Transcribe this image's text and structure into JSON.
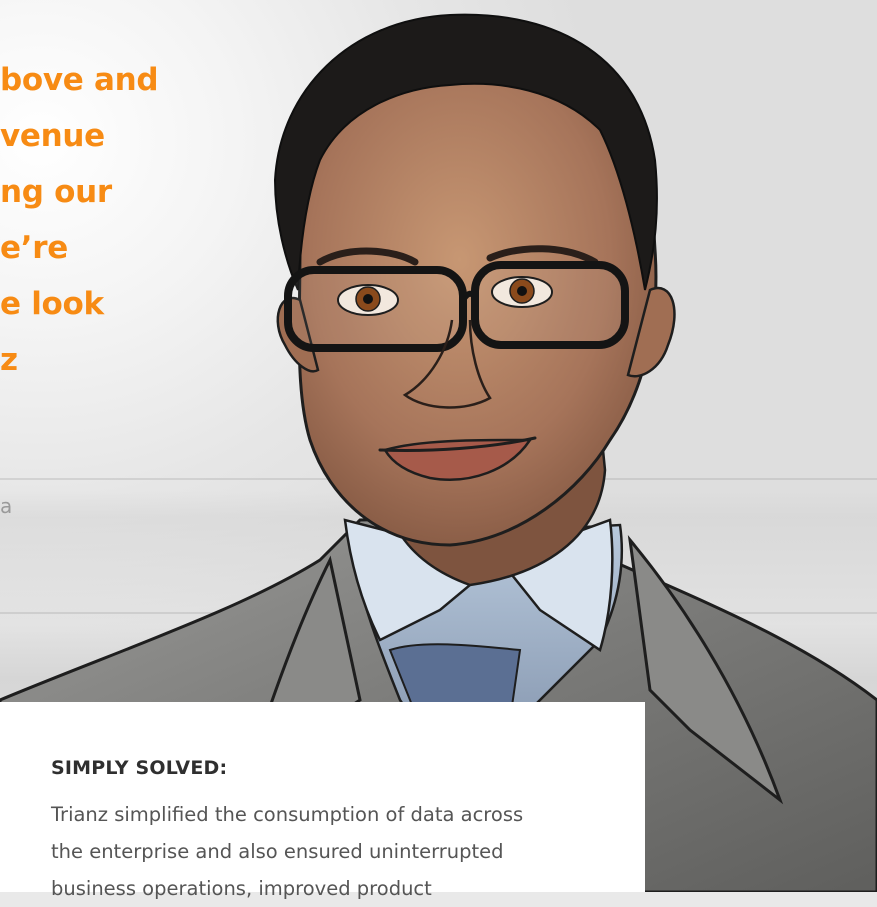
{
  "testimonial": {
    "quote_lines": [
      "bove and",
      "venue",
      "ng our",
      "e’re",
      "e look",
      "z"
    ],
    "attribution_fragment": "a"
  },
  "portrait": {
    "subject": "illustrated portrait of a smiling man with glasses in a grey suit jacket"
  },
  "solution_card": {
    "heading": "SIMPLY SOLVED:",
    "body_lines": [
      "Trianz simplified the consumption of data across",
      "the enterprise and also ensured uninterrupted",
      "business operations, improved product"
    ]
  },
  "colors": {
    "accent_orange": "#f78b14",
    "card_bg": "#ffffff",
    "heading_text": "#2f2f2f",
    "body_text": "#555555"
  }
}
